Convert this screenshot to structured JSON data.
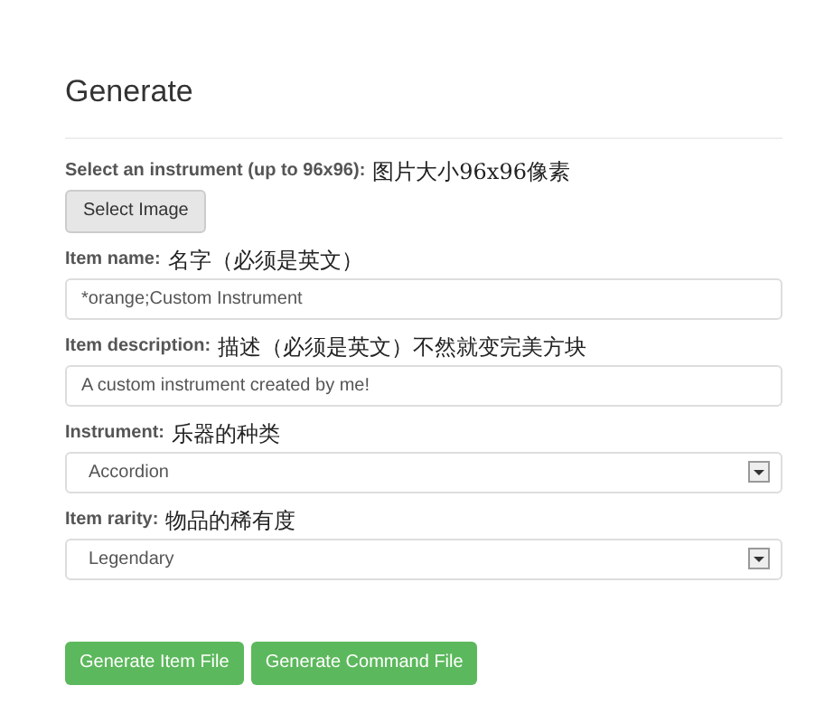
{
  "heading": "Generate",
  "image_field": {
    "label": "Select an instrument (up to 96x96):",
    "note": "图片大小96x96像素",
    "button": "Select Image"
  },
  "fields": [
    {
      "kind": "text",
      "label": "Item name:",
      "note": "名字（必须是英文）",
      "value": "*orange;Custom Instrument"
    },
    {
      "kind": "text",
      "label": "Item description:",
      "note": "描述（必须是英文）不然就变完美方块",
      "value": "A custom instrument created by me!"
    },
    {
      "kind": "select",
      "label": "Instrument:",
      "note": "乐器的种类",
      "value": "Accordion"
    },
    {
      "kind": "select",
      "label": "Item rarity:",
      "note": "物品的稀有度",
      "value": "Legendary"
    }
  ],
  "buttons": [
    "Generate Item File",
    "Generate Command File"
  ]
}
